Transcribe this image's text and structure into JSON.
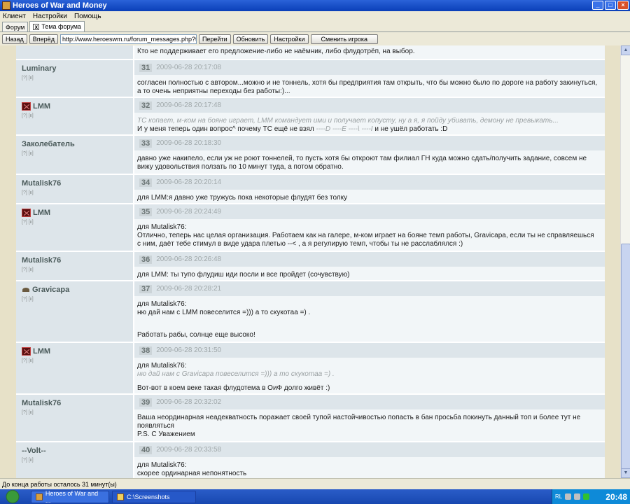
{
  "window": {
    "title": "Heroes of War and Money"
  },
  "menu": [
    "Клиент",
    "Настройки",
    "Помощь"
  ],
  "tabs": [
    {
      "label": "Форум"
    },
    {
      "label": "Тема форума"
    }
  ],
  "toolbar": {
    "back": "Назад",
    "forward": "Вперёд",
    "url": "http://www.heroeswm.ru/forum_messages.php?tid=3415",
    "go": "Перейти",
    "refresh": "Обновить",
    "settings": "Настройки",
    "switch_player": "Сменить игрока"
  },
  "top_text": "Кто не поддерживает его предложение-либо не наёмник, либо флудотрёп, на выбор.",
  "author_links": "[?] [к]",
  "posts": [
    {
      "author": "Luminary",
      "num": "31",
      "date": "2009-06-28 20:17:08",
      "text": "согласен полностью с автором...можно и не тоннель, хотя бы предприятия там открыть, что бы можно было по дороге на работу закинуться, а то очень неприятны переходы без работы:)..."
    },
    {
      "author": "LMM",
      "num": "32",
      "date": "2009-06-28 20:17:48",
      "quote": "ТС копает, м-ком на бояне играет, LMM командует ими и получает копусту, ну а я, я пойду убивать, демону не превыкать...",
      "text": "И у меня теперь один вопрос^ почему ТС ещё не взял",
      "text_quote": "----D ----E ----\\ ----I",
      "text_end": "и не ушёл работать :D"
    },
    {
      "author": "Заколебатель",
      "num": "33",
      "date": "2009-06-28 20:18:30",
      "text": "давно уже накипело, если уж не роют тоннелей, то пусть хотя бы откроют там филиал ГН куда можно сдать/получить задание, совсем не вижу удовольствия ползать по 10 минут туда, а потом обратно."
    },
    {
      "author": "Mutalisk76",
      "num": "34",
      "date": "2009-06-28 20:20:14",
      "text": "для LMM:я давно уже тружусь пока некоторые флудят без толку"
    },
    {
      "author": "LMM",
      "num": "35",
      "date": "2009-06-28 20:24:49",
      "line1": "для Mutalisk76:",
      "text": "Отлично, теперь нас целая организация. Работаем как на галере, м-ком играет на бояне темп работы, Gravicapa, если ты не справляешься с ним, даёт тебе стимул в виде удара плетью --< , а я регулирую темп, чтобы ты не расслаблялся :)"
    },
    {
      "author": "Mutalisk76",
      "num": "36",
      "date": "2009-06-28 20:26:48",
      "text": "для LMM: ты тупо флудиш иди посли и все пройдет (сочувствую)"
    },
    {
      "author": "Gravicapa",
      "num": "37",
      "date": "2009-06-28 20:28:21",
      "line1": "для Mutalisk76:",
      "text": "ню дай нам с LMM повеселится =))) а то скукотаа =) .",
      "tail": "Работать рабы, солнце еще высоко!"
    },
    {
      "author": "LMM",
      "num": "38",
      "date": "2009-06-28 20:31:50",
      "line1": "для Mutalisk76:",
      "quote": "ню дай нам с Gravicapa повеселится =))) а то скукотаа =) .",
      "tail": "Вот-вот в коем веке такая флудотема в ОиФ долго живёт :)"
    },
    {
      "author": "Mutalisk76",
      "num": "39",
      "date": "2009-06-28 20:32:02",
      "text": "Ваша неординарная неадекватность поражает своей тупой настойчивостью попасть в бан просьба покинуть данный топ и более тут не появляться",
      "tail": "P.S. С Уважением"
    },
    {
      "author": "--Volt--",
      "num": "40",
      "date": "2009-06-28 20:33:58",
      "line1": "для Mutalisk76:",
      "text": "скорее ординарная непонятность"
    }
  ],
  "status": "До конца работы осталось 31 минут(ы)",
  "taskbar": {
    "items": [
      "Heroes of War and ...",
      "C:\\Screenshots"
    ],
    "lang": "RL",
    "clock": "20:48"
  }
}
